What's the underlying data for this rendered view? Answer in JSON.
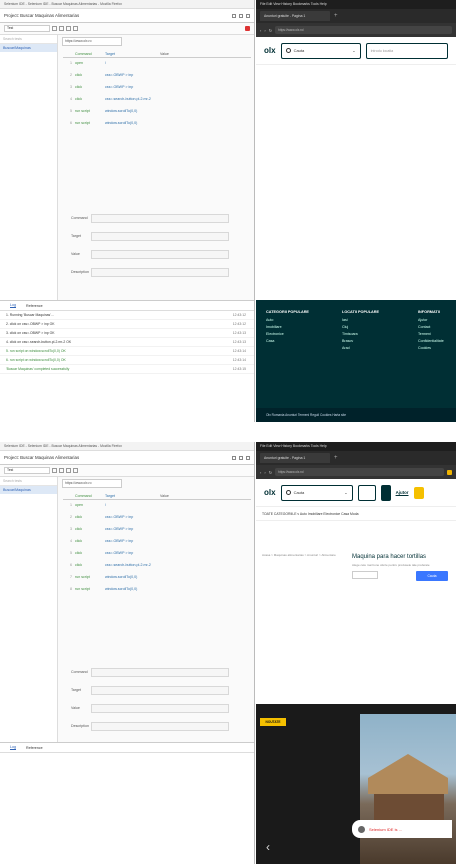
{
  "ide": {
    "window_title": "Selenium IDE - Selenium IDE - Buscar Maquinas Alimentarias - Mozilla Firefox",
    "tab_title": "Project: Buscar Maquinas Alimentarias",
    "toolbar_select": "Test",
    "url_field": "https://www.olx.ro",
    "left_search_placeholder": "Search tests",
    "left_items": [
      "Buscar/Maquinas"
    ],
    "table_headers": {
      "command": "Command",
      "target": "Target",
      "value": "Value"
    },
    "form_labels": {
      "command": "Command",
      "target": "Target",
      "value": "Value",
      "description": "Description"
    },
    "log_tabs": [
      "Log",
      "Reference"
    ]
  },
  "shot1": {
    "commands": [
      {
        "num": "1",
        "command": "open",
        "target": "/",
        "value": ""
      },
      {
        "num": "2",
        "command": "click",
        "target": "css=.OBWP > inp",
        "value": ""
      },
      {
        "num": "3",
        "command": "click",
        "target": "css=.OBWP > inp",
        "value": ""
      },
      {
        "num": "4",
        "command": "click",
        "target": "css=.search-button.pl-2.mr-2",
        "value": ""
      },
      {
        "num": "5",
        "command": "run script",
        "target": "window.scrollTo(0,0)",
        "value": ""
      },
      {
        "num": "6",
        "command": "run script",
        "target": "window.scrollTo(0,0)",
        "value": ""
      }
    ],
    "log_lines": [
      {
        "text": "1. Running 'Buscar Maquinas'...",
        "time": "12:43:12",
        "ok": false
      },
      {
        "text": "2. click on css=.OBWP > inp OK",
        "time": "12:43:12",
        "ok": false
      },
      {
        "text": "3. click on css=.OBWP > inp OK",
        "time": "12:43:13",
        "ok": false
      },
      {
        "text": "4. click on css=.search-button.pl-2.mr-2 OK",
        "time": "12:43:13",
        "ok": false
      },
      {
        "text": "5. run script on window.scrollTo(0,0) OK",
        "time": "12:43:14",
        "ok": true
      },
      {
        "text": "6. run script on window.scrollTo(0,0) OK",
        "time": "12:43:14",
        "ok": true
      },
      {
        "text": "'Buscar Maquinas' completed successfully",
        "time": "12:43:15",
        "ok": true
      }
    ]
  },
  "shot2": {
    "commands": [
      {
        "num": "1",
        "command": "open",
        "target": "/",
        "value": ""
      },
      {
        "num": "2",
        "command": "click",
        "target": "css=.OBWP > inp",
        "value": ""
      },
      {
        "num": "3",
        "command": "click",
        "target": "css=.OBWP > inp",
        "value": ""
      },
      {
        "num": "4",
        "command": "click",
        "target": "css=.OBWP > inp",
        "value": ""
      },
      {
        "num": "5",
        "command": "click",
        "target": "css=.OBWP > inp",
        "value": ""
      },
      {
        "num": "6",
        "command": "click",
        "target": "css=.search-button.pl-2.mr-2",
        "value": ""
      },
      {
        "num": "7",
        "command": "run script",
        "target": "window.scrollTo(0,0)",
        "value": ""
      },
      {
        "num": "8",
        "command": "run script",
        "target": "window.scrollTo(0,0)",
        "value": ""
      }
    ]
  },
  "browser": {
    "menubar": "File  Edit  View  History  Bookmarks  Tools  Help",
    "tab_title": "Anunturi gratuite - Pagina 1",
    "address": "https://www.olx.ro/",
    "olx_logo": "olx",
    "search_text": "Cauta",
    "location_placeholder": "Introdu locatia",
    "ajutor": "Ajutor",
    "footer_cols": [
      {
        "title": "CATEGORII POPULARE",
        "items": [
          "Auto",
          "Imobiliare",
          "Electronice",
          "Casa"
        ]
      },
      {
        "title": "LOCATII POPULARE",
        "items": [
          "Iasi",
          "Cluj",
          "Timisoara",
          "Brasov",
          "Arad"
        ]
      },
      {
        "title": "INFORMATII",
        "items": [
          "Ajutor",
          "Contact",
          "Termeni",
          "Confidentialitate",
          "Cookies"
        ]
      }
    ],
    "footer_bar": "Olx Romania  Anunturi  Termeni  Reguli  Cookies  Harta site",
    "nav_categories": "TOATE CATEGORIILE  v   Auto   Imobiliare   Electronice   Casa   Moda",
    "breadcrumb": "Acasa > Maquinas alimentarias > Anunturi > Alimentare",
    "promo_title": "Maquina para hacer tortillas",
    "promo_text": "Alege cele mai bune oferte pentru produsele tale preferate",
    "promo_button": "Cauta",
    "hero_badge": "NOUTATE",
    "hero_toast": "Selenium IDE is ..."
  }
}
